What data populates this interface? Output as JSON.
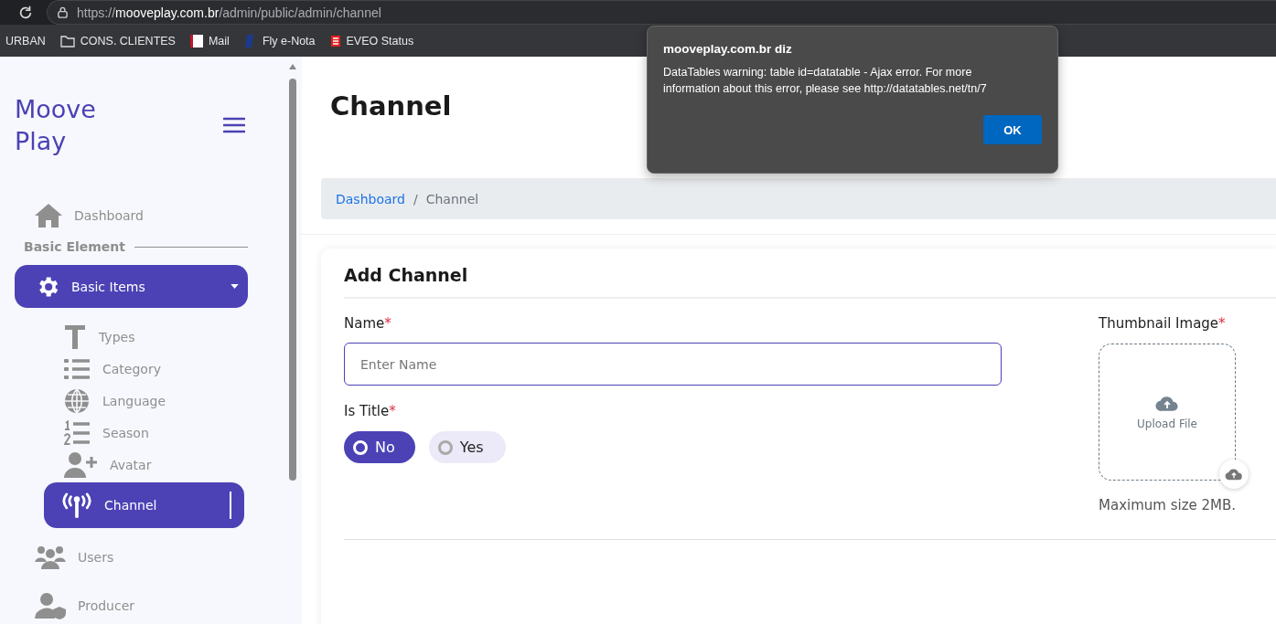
{
  "browser": {
    "url": "https://**mooveplay.com.br**/admin/public/admin/channel",
    "bookmarks": [
      {
        "label": "URBAN",
        "kind": "plain"
      },
      {
        "label": "CONS. CLIENTES",
        "kind": "folder"
      },
      {
        "label": "Mail",
        "kind": "mail"
      },
      {
        "label": "Fly e-Nota",
        "kind": "fly"
      },
      {
        "label": "EVEO Status",
        "kind": "eveo"
      }
    ]
  },
  "sidebar": {
    "logo": "Moove Play",
    "items": [
      {
        "kind": "link",
        "label": "Dashboard",
        "selected": false
      },
      {
        "kind": "section",
        "label": "Basic Element"
      },
      {
        "kind": "group",
        "label": "Basic Items",
        "selected": true,
        "expanded": true,
        "children": [
          {
            "label": "Types",
            "selected": false
          },
          {
            "label": "Category",
            "selected": false
          },
          {
            "label": "Language",
            "selected": false
          },
          {
            "label": "Season",
            "selected": false
          },
          {
            "label": "Avatar",
            "selected": false
          },
          {
            "label": "Channel",
            "selected": true
          }
        ]
      },
      {
        "kind": "link",
        "label": "Users",
        "selected": false
      },
      {
        "kind": "link",
        "label": "Producer",
        "selected": false
      }
    ]
  },
  "page": {
    "title": "Channel",
    "breadcrumb": [
      {
        "label": "Dashboard",
        "link": true
      },
      {
        "separator": "/",
        "label": "Channel",
        "link": false
      }
    ]
  },
  "card": {
    "title": "Add Channel",
    "name_field": {
      "label": "Name",
      "required_mark": "*",
      "placeholder": "Enter Name"
    },
    "is_title": {
      "label": "Is Title",
      "required_mark": "*",
      "options": [
        {
          "label": "No",
          "selected": true
        },
        {
          "label": "Yes",
          "selected": false
        }
      ]
    },
    "thumbnail": {
      "label": "Thumbnail Image",
      "required_mark": "*",
      "upload": "Upload File",
      "hint": "Maximum size 2MB."
    }
  },
  "dialog": {
    "title": "mooveplay.com.br diz",
    "message": "DataTables warning: table id=datatable - Ajax error. For more information about this error, please see http://datatables.net/tn/7",
    "button": "OK"
  }
}
